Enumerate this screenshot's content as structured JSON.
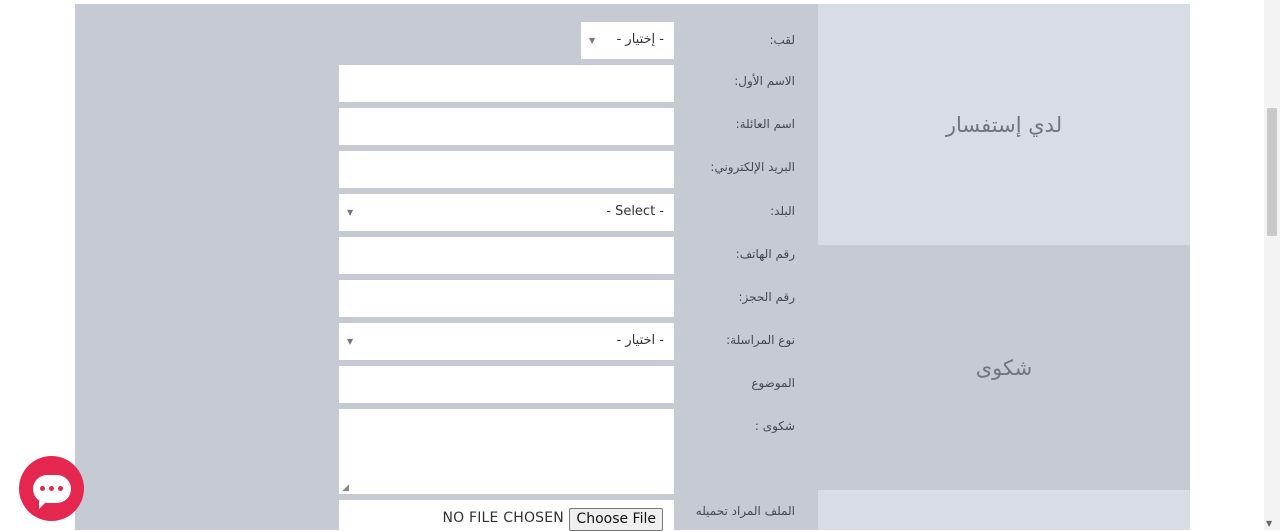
{
  "colors": {
    "panel_bg": "#c5cad3",
    "tab_light": "#d8dce4",
    "accent_chat": "#e5264f"
  },
  "side_tabs": {
    "inquiry": "لدي إستفسار",
    "complaint": "شكوى",
    "third": ""
  },
  "form": {
    "title_label": "لقب:",
    "title_select": "- إختيار -",
    "first_name_label": "الاسم الأول:",
    "last_name_label": "اسم العائلة:",
    "email_label": "البريد الإلكتروني:",
    "country_label": "البلد:",
    "country_select": "- Select -",
    "phone_label": "رقم الهاتف:",
    "booking_label": "رقم الحجز:",
    "correspondence_label": "نوع المراسلة:",
    "correspondence_select": "- اختيار -",
    "subject_label": "الموضوع",
    "complaint_label": "شكوى :",
    "file_label": "الملف المراد تحميله",
    "file_status": "NO FILE CHOSEN",
    "file_button": "Choose File"
  },
  "icons": {
    "dropdown": "caret-down-icon",
    "chat": "chat-icon",
    "resize": "resize-handle-icon",
    "scroll_down": "scroll-down-icon"
  }
}
